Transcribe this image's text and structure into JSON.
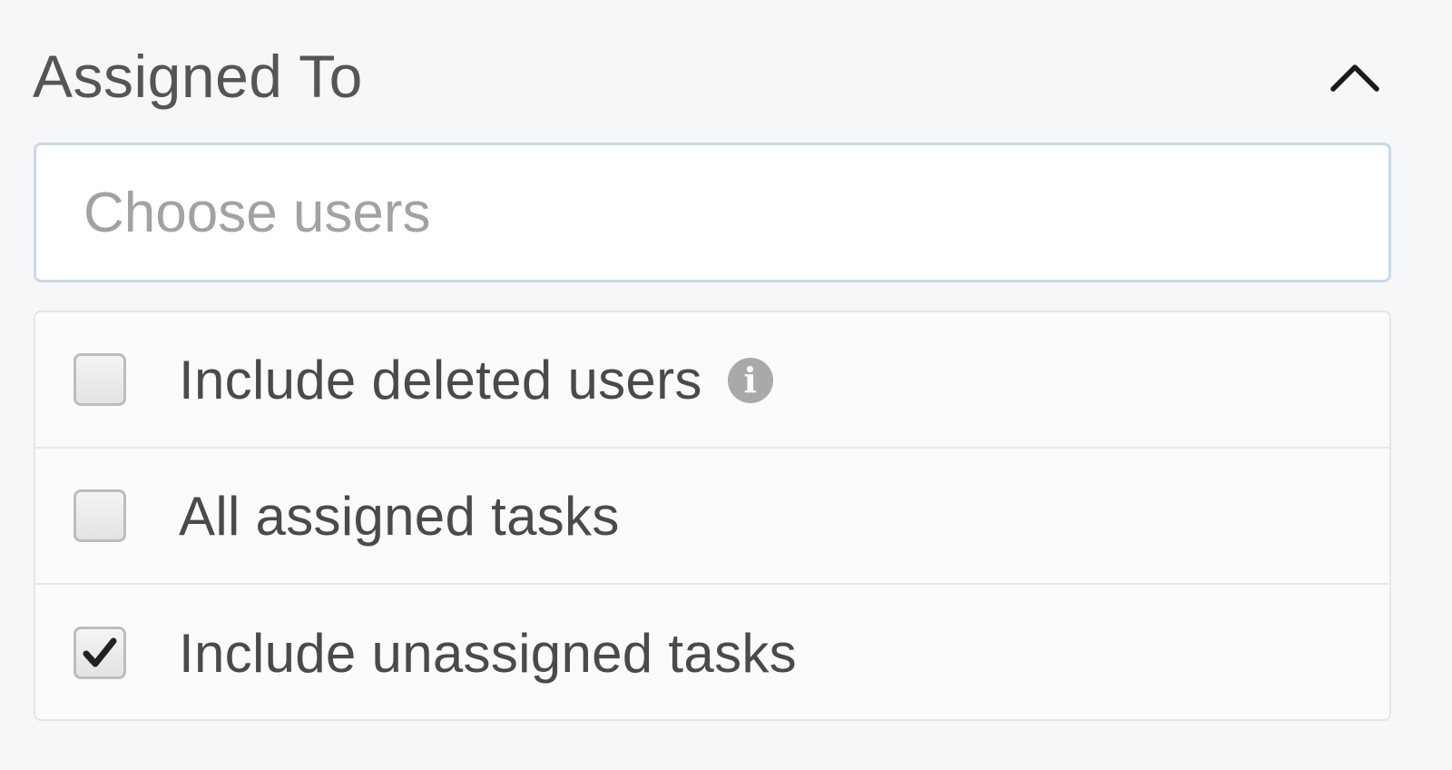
{
  "filter": {
    "title": "Assigned To",
    "collapse_icon": "chevron-up-icon",
    "search": {
      "placeholder": "Choose users",
      "value": ""
    },
    "options": [
      {
        "label": "Include deleted users",
        "checked": false,
        "info_icon": "info-icon",
        "info_glyph": "i"
      },
      {
        "label": "All assigned tasks",
        "checked": false
      },
      {
        "label": "Include unassigned tasks",
        "checked": true
      }
    ]
  },
  "colors": {
    "background": "#f6f7f9",
    "input_border": "#c9d9ea",
    "text": "#4a4a4a",
    "placeholder": "#a2a2a2"
  }
}
